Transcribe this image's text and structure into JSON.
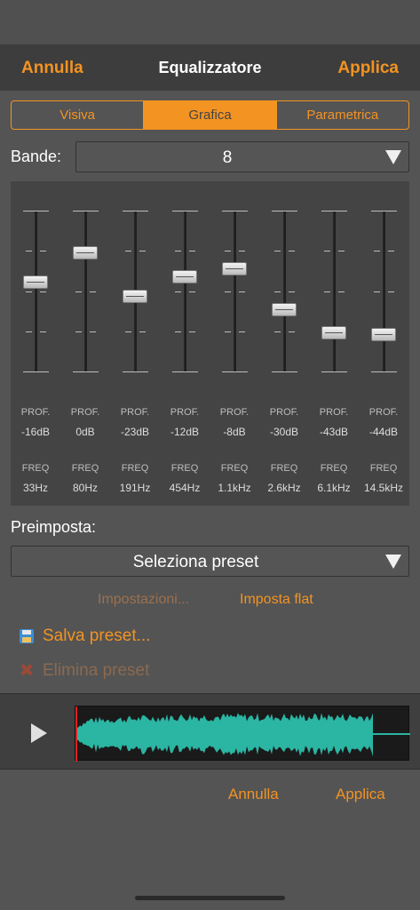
{
  "nav": {
    "cancel": "Annulla",
    "title": "Equalizzatore",
    "apply": "Applica"
  },
  "tabs": [
    {
      "label": "Visiva",
      "active": false
    },
    {
      "label": "Grafica",
      "active": true
    },
    {
      "label": "Parametrica",
      "active": false
    }
  ],
  "bands": {
    "label": "Bande:",
    "value": "8"
  },
  "eq": {
    "depth_label": "PROF.",
    "freq_label": "FREQ",
    "range_db": [
      -100,
      100
    ],
    "bands": [
      {
        "gain": "-16dB",
        "freq": "33Hz",
        "level": 0.56
      },
      {
        "gain": "0dB",
        "freq": "80Hz",
        "level": 0.76
      },
      {
        "gain": "-23dB",
        "freq": "191Hz",
        "level": 0.47
      },
      {
        "gain": "-12dB",
        "freq": "454Hz",
        "level": 0.6
      },
      {
        "gain": "-8dB",
        "freq": "1.1kHz",
        "level": 0.65
      },
      {
        "gain": "-30dB",
        "freq": "2.6kHz",
        "level": 0.38
      },
      {
        "gain": "-43dB",
        "freq": "6.1kHz",
        "level": 0.22
      },
      {
        "gain": "-44dB",
        "freq": "14.5kHz",
        "level": 0.21
      }
    ]
  },
  "preset": {
    "label": "Preimposta:",
    "value": "Seleziona preset"
  },
  "actions": {
    "settings": "Impostazioni...",
    "flat": "Imposta flat",
    "save": "Salva preset...",
    "delete": "Elimina preset"
  },
  "footer": {
    "cancel": "Annulla",
    "apply": "Applica"
  },
  "colors": {
    "accent": "#f39322",
    "waveform": "#2bb5a3",
    "playhead": "#e02020"
  },
  "icons": {
    "save": "floppy-disk-icon",
    "delete": "delete-x-icon",
    "play": "play-icon",
    "dropdown": "triangle-down-icon"
  }
}
